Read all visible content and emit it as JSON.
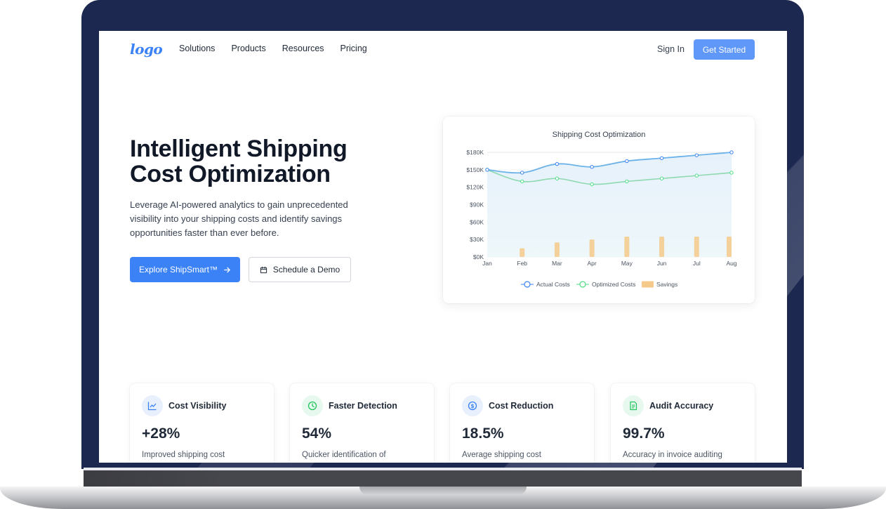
{
  "nav": {
    "logo": "logo",
    "links": [
      "Solutions",
      "Products",
      "Resources",
      "Pricing"
    ],
    "sign_in": "Sign In",
    "get_started": "Get Started"
  },
  "hero": {
    "title_line1": "Intelligent Shipping",
    "title_line2": "Cost Optimization",
    "subtitle": "Leverage AI-powered analytics to gain unprecedented visibility into your shipping costs and identify savings opportunities faster than ever before.",
    "primary_cta": "Explore ShipSmart™",
    "primary_cta_icon": "arrow-right-icon",
    "secondary_cta": "Schedule a Demo",
    "secondary_cta_icon": "calendar-icon"
  },
  "chart_data": {
    "type": "line",
    "title": "Shipping Cost Optimization",
    "categories": [
      "Jan",
      "Feb",
      "Mar",
      "Apr",
      "May",
      "Jun",
      "Jul",
      "Aug"
    ],
    "y_ticks": [
      "$0K",
      "$30K",
      "$60K",
      "$90K",
      "$120K",
      "$150K",
      "$180K"
    ],
    "ylim": [
      0,
      180000
    ],
    "series": [
      {
        "name": "Actual Costs",
        "type": "line",
        "color": "#3b82f6",
        "values": [
          150000,
          145000,
          160000,
          155000,
          165000,
          170000,
          175000,
          180000
        ]
      },
      {
        "name": "Optimized Costs",
        "type": "line",
        "color": "#4ade80",
        "values": [
          150000,
          130000,
          135000,
          125000,
          130000,
          135000,
          140000,
          145000
        ]
      },
      {
        "name": "Savings",
        "type": "bar",
        "color": "#f5c98a",
        "values": [
          0,
          15000,
          25000,
          30000,
          35000,
          35000,
          35000,
          35000
        ]
      }
    ],
    "legend_position": "bottom",
    "grid": true
  },
  "stats": [
    {
      "icon": "line-chart-icon",
      "icon_color": "#3b82f6",
      "icon_bg": "#e8f0fe",
      "title": "Cost Visibility",
      "value": "+28%",
      "desc": "Improved shipping cost"
    },
    {
      "icon": "clock-icon",
      "icon_color": "#22c55e",
      "icon_bg": "#e7f8ee",
      "title": "Faster Detection",
      "value": "54%",
      "desc": "Quicker identification of"
    },
    {
      "icon": "dollar-icon",
      "icon_color": "#3b82f6",
      "icon_bg": "#e8f0fe",
      "title": "Cost Reduction",
      "value": "18.5%",
      "desc": "Average shipping cost"
    },
    {
      "icon": "document-icon",
      "icon_color": "#22c55e",
      "icon_bg": "#e7f8ee",
      "title": "Audit Accuracy",
      "value": "99.7%",
      "desc": "Accuracy in invoice auditing"
    }
  ]
}
